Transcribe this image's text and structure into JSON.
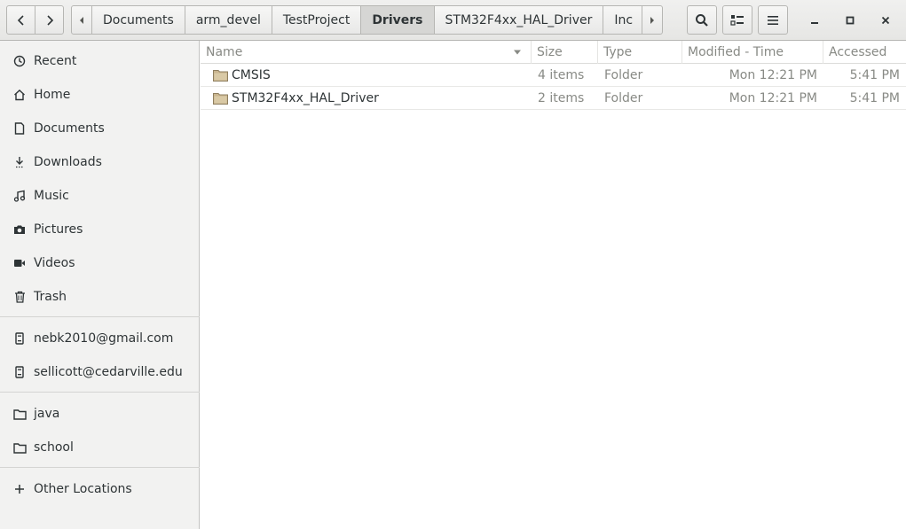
{
  "header": {
    "breadcrumbs": [
      "Documents",
      "arm_devel",
      "TestProject",
      "Drivers",
      "STM32F4xx_HAL_Driver",
      "Inc"
    ],
    "active_crumb": "Drivers"
  },
  "sidebar": {
    "places": [
      {
        "label": "Recent",
        "icon": "clock-icon"
      },
      {
        "label": "Home",
        "icon": "home-icon"
      },
      {
        "label": "Documents",
        "icon": "document-icon"
      },
      {
        "label": "Downloads",
        "icon": "download-icon"
      },
      {
        "label": "Music",
        "icon": "music-icon"
      },
      {
        "label": "Pictures",
        "icon": "camera-icon"
      },
      {
        "label": "Videos",
        "icon": "video-icon"
      },
      {
        "label": "Trash",
        "icon": "trash-icon"
      }
    ],
    "accounts": [
      {
        "label": "nebk2010@gmail.com",
        "icon": "network-drive-icon"
      },
      {
        "label": "sellicott@cedarville.edu",
        "icon": "network-drive-icon"
      }
    ],
    "bookmarks": [
      {
        "label": "java",
        "icon": "folder-icon"
      },
      {
        "label": "school",
        "icon": "folder-icon"
      }
    ],
    "other": {
      "label": "Other Locations",
      "icon": "plus-icon"
    }
  },
  "columns": {
    "name": "Name",
    "size": "Size",
    "type": "Type",
    "modified": "Modified - Time",
    "accessed": "Accessed"
  },
  "files": [
    {
      "name": "CMSIS",
      "size": "4 items",
      "type": "Folder",
      "modified": "Mon 12:21 PM",
      "accessed": "5:41 PM"
    },
    {
      "name": "STM32F4xx_HAL_Driver",
      "size": "2 items",
      "type": "Folder",
      "modified": "Mon 12:21 PM",
      "accessed": "5:41 PM"
    }
  ],
  "colors": {
    "folder": "#c9b58f",
    "sidebar_bg": "#f2f2f1",
    "active_crumb_bg": "#d6d6d4"
  }
}
